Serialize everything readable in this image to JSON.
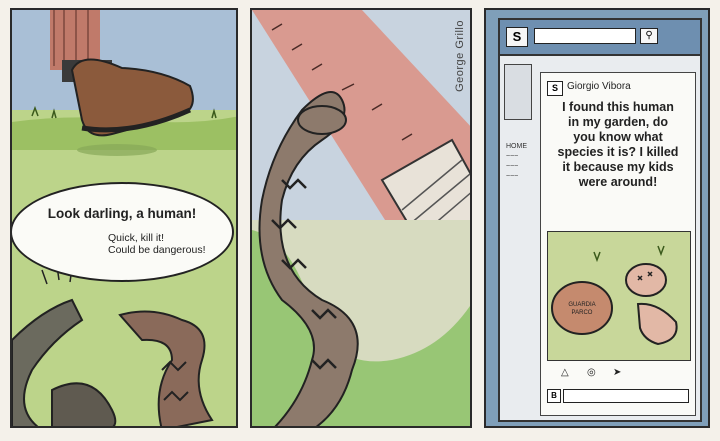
{
  "panel1": {
    "speech_main": "Look darling, a human!",
    "speech_sub_1": "Quick, kill it!",
    "speech_sub_2": "Could be dangerous!"
  },
  "panel2": {
    "artist_credit": "George Grillo"
  },
  "panel3": {
    "browser": {
      "logo_letter": "S",
      "search_icon": "magnifier-icon"
    },
    "left_column_lines": [
      "HOME",
      "~~~",
      "~~~",
      "~~~"
    ],
    "post": {
      "author": "Giorgio Vibora",
      "text_lines": [
        "I found this human",
        "in my garden, do",
        "you know what",
        "species it is? I killed",
        "it because my kids",
        "were around!"
      ],
      "cap_text_1": "GUARDIA",
      "cap_text_2": "PARCO",
      "action_icons": [
        "like-icon",
        "comment-icon",
        "share-icon"
      ],
      "comment_icon_letter": "B"
    }
  }
}
